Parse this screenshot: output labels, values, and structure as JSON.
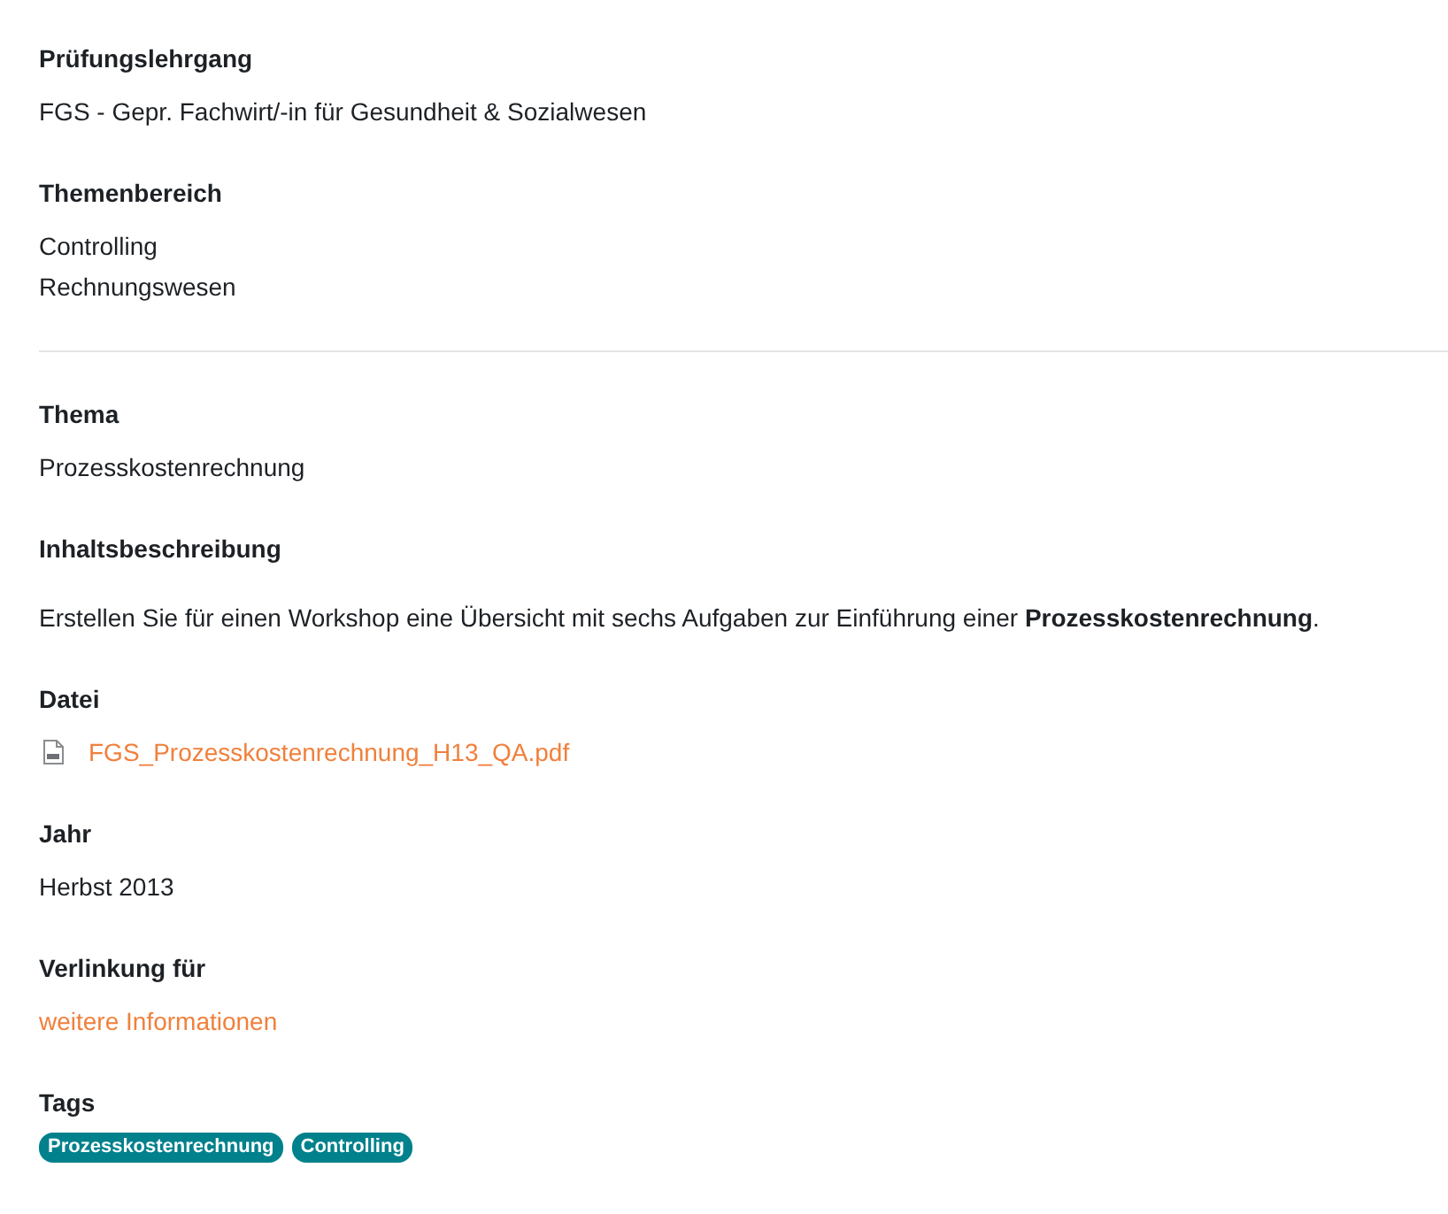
{
  "groups": [
    [
      {
        "heading": "Prüfungslehrgang",
        "kind": "text",
        "lines": [
          "FGS - Gepr. Fachwirt/-in für Gesundheit & Sozialwesen"
        ]
      },
      {
        "heading": "Themenbereich",
        "kind": "text",
        "lines": [
          "Controlling",
          "Rechnungswesen"
        ]
      }
    ],
    [
      {
        "heading": "Thema",
        "kind": "text",
        "lines": [
          "Prozesskostenrechnung"
        ]
      },
      {
        "heading": "Inhaltsbeschreibung",
        "kind": "paragraph",
        "text": "Erstellen Sie für einen Workshop eine Übersicht mit sechs Aufgaben zur Einführung einer **Prozesskostenrechnung**."
      },
      {
        "heading": "Datei",
        "kind": "file",
        "text": "FGS_Prozesskostenrechnung_H13_QA.pdf"
      },
      {
        "heading": "Jahr",
        "kind": "text",
        "lines": [
          "Herbst 2013"
        ]
      },
      {
        "heading": "Verlinkung für",
        "kind": "link",
        "text": "weitere Informationen"
      },
      {
        "heading": "Tags",
        "kind": "tags",
        "tags": [
          "Prozesskostenrechnung",
          "Controlling"
        ]
      }
    ]
  ]
}
